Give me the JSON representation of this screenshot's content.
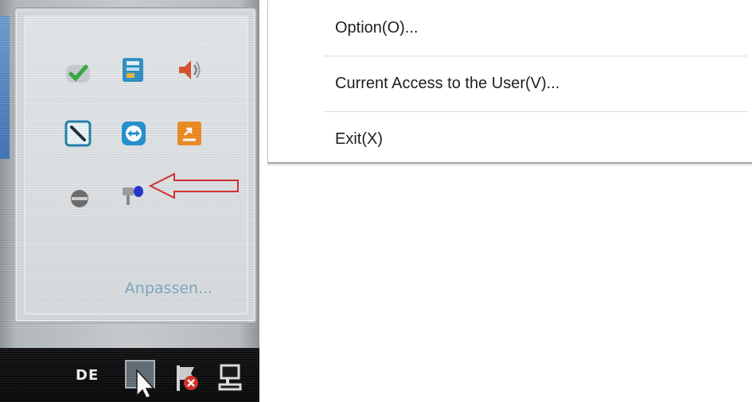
{
  "tray": {
    "customize_label": "Anpassen...",
    "language_indicator": "DE",
    "icons": [
      "security-check-icon",
      "network-app-icon",
      "volume-speaker-icon",
      "tool-window-icon",
      "teamviewer-icon",
      "upload-app-icon",
      "round-gray-icon",
      "microphone-user-icon"
    ],
    "taskbar_icons": [
      "show-hidden-icons-icon",
      "action-center-flag-icon",
      "network-monitor-icon"
    ]
  },
  "annotation": {
    "arrow_color": "#d22a2a"
  },
  "context_menu": {
    "items": [
      {
        "label": "Option(O)..."
      },
      {
        "label": "Current Access to the User(V)..."
      },
      {
        "label": "Exit(X)"
      }
    ]
  }
}
